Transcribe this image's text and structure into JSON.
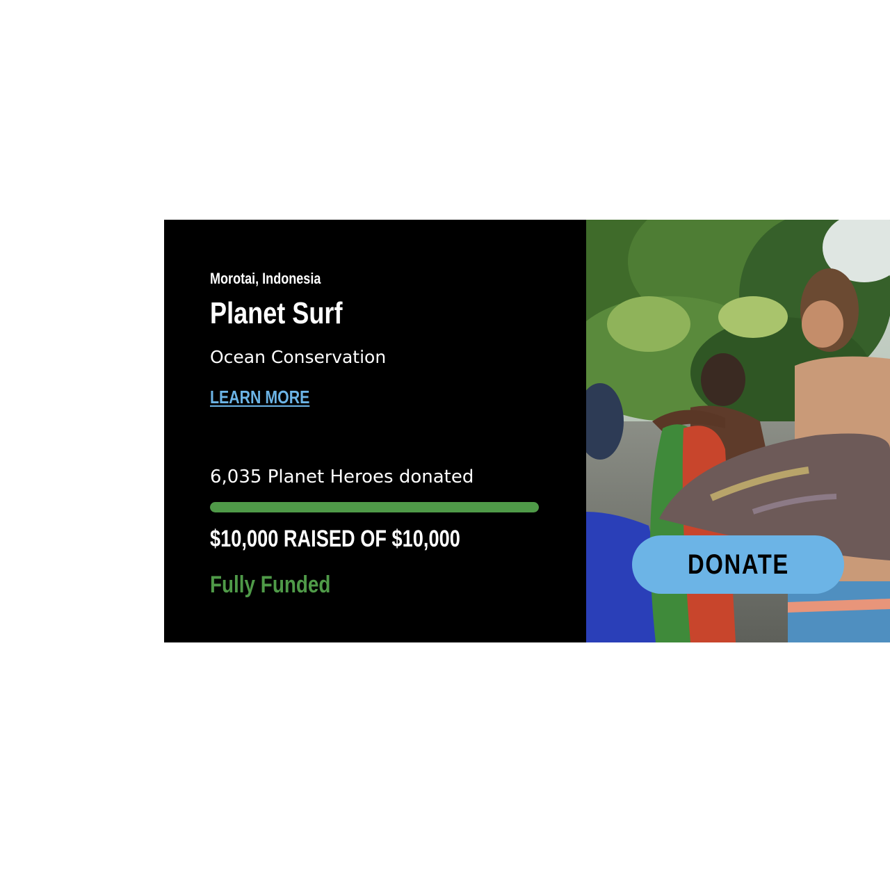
{
  "project": {
    "location": "Morotai, Indonesia",
    "title": "Planet Surf",
    "category": "Ocean Conservation",
    "learn_more_label": "LEARN MORE",
    "donors_text": "6,035 Planet Heroes donated",
    "raised_text": "$10,000 RAISED OF $10,000",
    "status_text": "Fully Funded",
    "progress_fraction": 1.0,
    "donate_label": "DONATE"
  },
  "colors": {
    "card_background": "#000000",
    "progress_fill": "#4f9a48",
    "status": "#4f9a48",
    "link": "#6cb4e6",
    "donate_button": "#6cb4e6"
  }
}
